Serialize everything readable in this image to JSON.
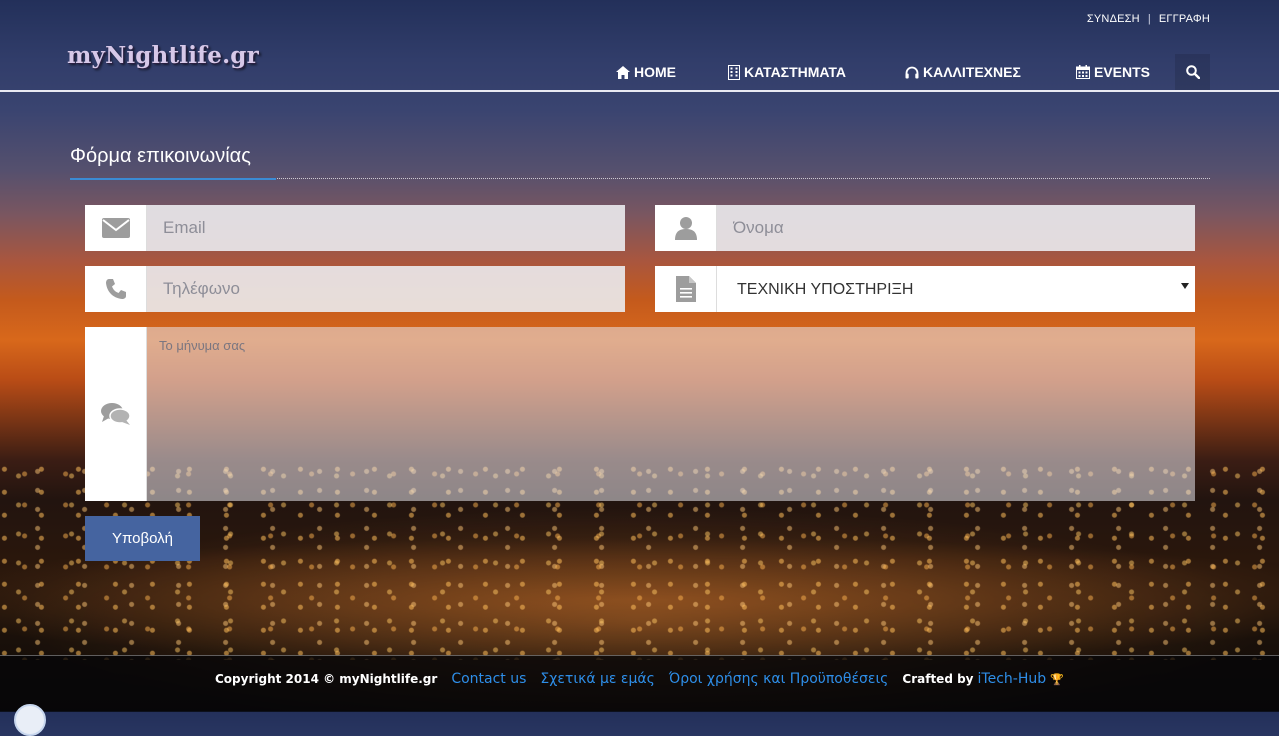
{
  "header": {
    "logo": "myNightlife.gr",
    "top_links": {
      "login": "ΣΥΝΔΕΣΗ",
      "separator": "|",
      "register": "ΕΓΓΡΑΦΗ"
    },
    "nav": {
      "home": "HOME",
      "stores": "ΚΑΤΑΣΤΗΜΑΤΑ",
      "artists": "ΚΑΛΛΙΤΕΧΝΕΣ",
      "events": "EVENTS"
    },
    "icons": {
      "home": "home-icon",
      "stores": "building-icon",
      "artists": "headphones-icon",
      "events": "calendar-icon",
      "search": "search-icon"
    }
  },
  "form": {
    "title": "Φόρμα επικοινωνίας",
    "email_placeholder": "Email",
    "name_placeholder": "Όνομα",
    "phone_placeholder": "Τηλέφωνο",
    "subject_selected": "ΤΕΧΝΙΚΗ ΥΠΟΣΤΗΡΙΞΗ",
    "message_placeholder": "Το μήνυμα σας",
    "submit_label": "Υποβολή",
    "icons": {
      "email": "envelope-icon",
      "name": "user-icon",
      "phone": "phone-icon",
      "subject": "document-icon",
      "message": "comments-icon"
    }
  },
  "footer": {
    "copyright": "Copyright 2014 © myNightlife.gr",
    "contact": "Contact us",
    "about": "Σχετικά με εμάς",
    "terms": "Όροι χρήσης και Προϋποθέσεις",
    "crafted_by": "Crafted by",
    "crafter": "iTech-Hub"
  },
  "colors": {
    "accent": "#3b8bd4",
    "submit": "#4564a0",
    "link": "#2e8ee8"
  }
}
